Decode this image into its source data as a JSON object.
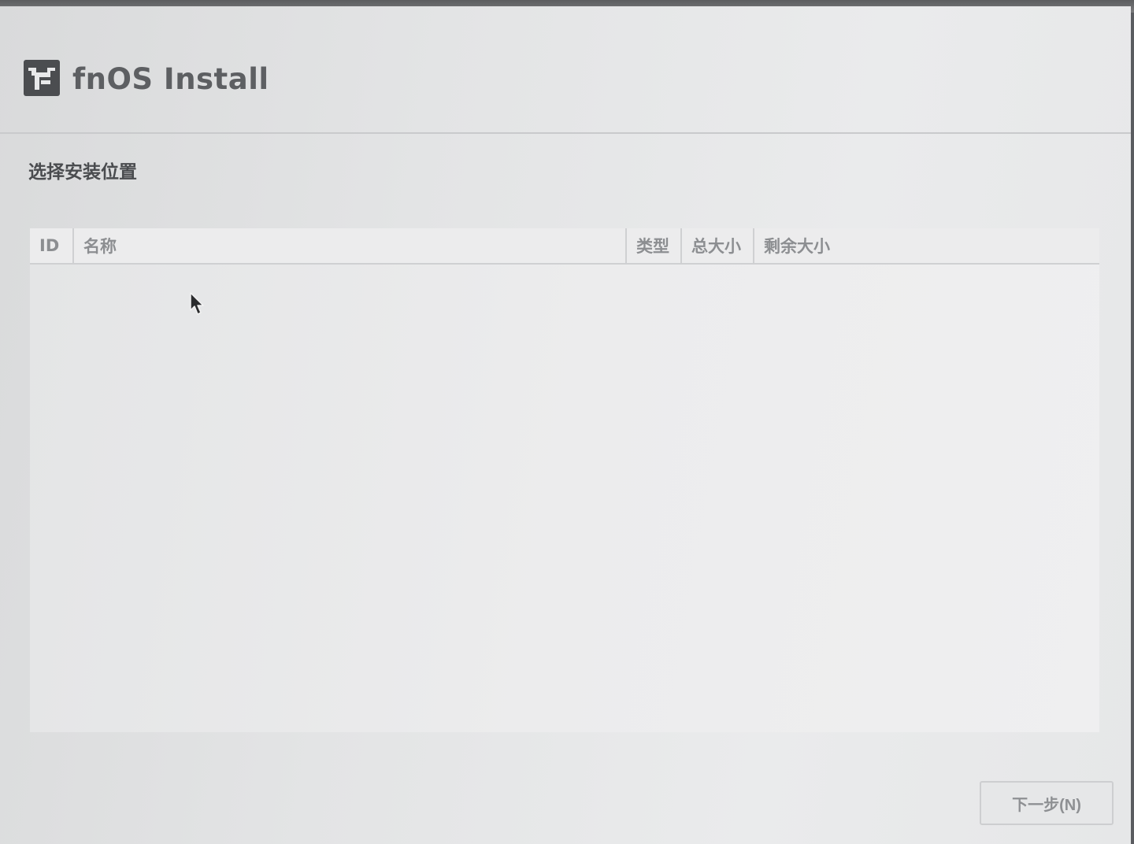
{
  "app": {
    "title": "fnOS Install",
    "logo_icon": "fnos-logo-icon"
  },
  "section": {
    "title": "选择安装位置"
  },
  "table": {
    "columns": [
      "ID",
      "名称",
      "类型",
      "总大小",
      "剩余大小"
    ],
    "rows": []
  },
  "footer": {
    "next_label": "下一步(N)"
  },
  "colors": {
    "background": "#e3e4e5",
    "text_dark": "#4a4c4f",
    "text_muted": "#8c8e91",
    "logo": "#4b4d50"
  }
}
